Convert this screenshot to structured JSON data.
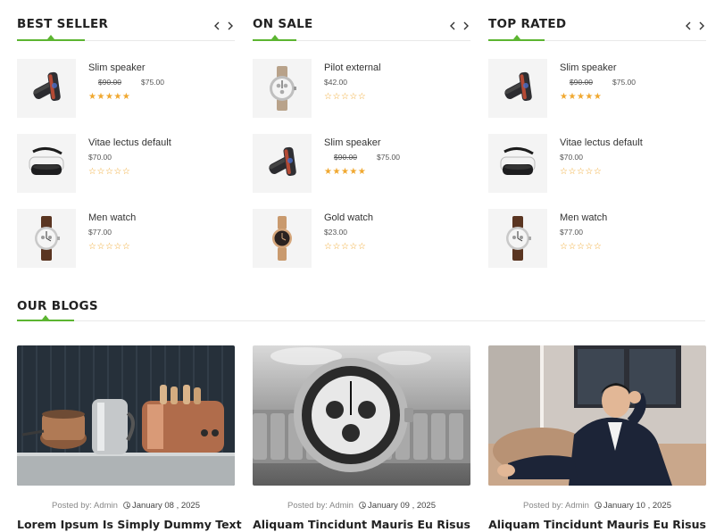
{
  "colors": {
    "accent": "#5cb531",
    "star": "#f0a830",
    "star_empty": "#f0a830"
  },
  "sections": [
    {
      "title": "BEST SELLER",
      "products": [
        {
          "name": "Slim speaker",
          "old_price": "$90.00",
          "price": "$75.00",
          "rating": 5,
          "thumb": "speaker"
        },
        {
          "name": "Vitae lectus default",
          "old_price": "",
          "price": "$70.00",
          "rating": 0,
          "thumb": "vr-headset"
        },
        {
          "name": "Men watch",
          "old_price": "",
          "price": "$77.00",
          "rating": 0,
          "thumb": "men-watch"
        }
      ]
    },
    {
      "title": "ON SALE",
      "products": [
        {
          "name": "Pilot external",
          "old_price": "",
          "price": "$42.00",
          "rating": 0,
          "thumb": "steel-watch"
        },
        {
          "name": "Slim speaker",
          "old_price": "$90.00",
          "price": "$75.00",
          "rating": 5,
          "thumb": "speaker"
        },
        {
          "name": "Gold watch",
          "old_price": "",
          "price": "$23.00",
          "rating": 0,
          "thumb": "gold-watch"
        }
      ]
    },
    {
      "title": "TOP RATED",
      "products": [
        {
          "name": "Slim speaker",
          "old_price": "$90.00",
          "price": "$75.00",
          "rating": 5,
          "thumb": "speaker"
        },
        {
          "name": "Vitae lectus default",
          "old_price": "",
          "price": "$70.00",
          "rating": 0,
          "thumb": "vr-headset"
        },
        {
          "name": "Men watch",
          "old_price": "",
          "price": "$77.00",
          "rating": 0,
          "thumb": "men-watch"
        }
      ]
    }
  ],
  "blogs": {
    "title": "OUR BLOGS",
    "posts": [
      {
        "posted_by": "Posted by: Admin",
        "date": "January 08 , 2025",
        "title": "Lorem Ipsum Is Simply Dummy Text",
        "image": "kitchen-appliances"
      },
      {
        "posted_by": "Posted by: Admin",
        "date": "January 09 , 2025",
        "title": "Aliquam Tincidunt Mauris Eu Risus",
        "image": "chronograph-watch"
      },
      {
        "posted_by": "Posted by: Admin",
        "date": "January 10 , 2025",
        "title": "Aliquam Tincidunt Mauris Eu Risus",
        "image": "man-in-suit"
      }
    ]
  }
}
